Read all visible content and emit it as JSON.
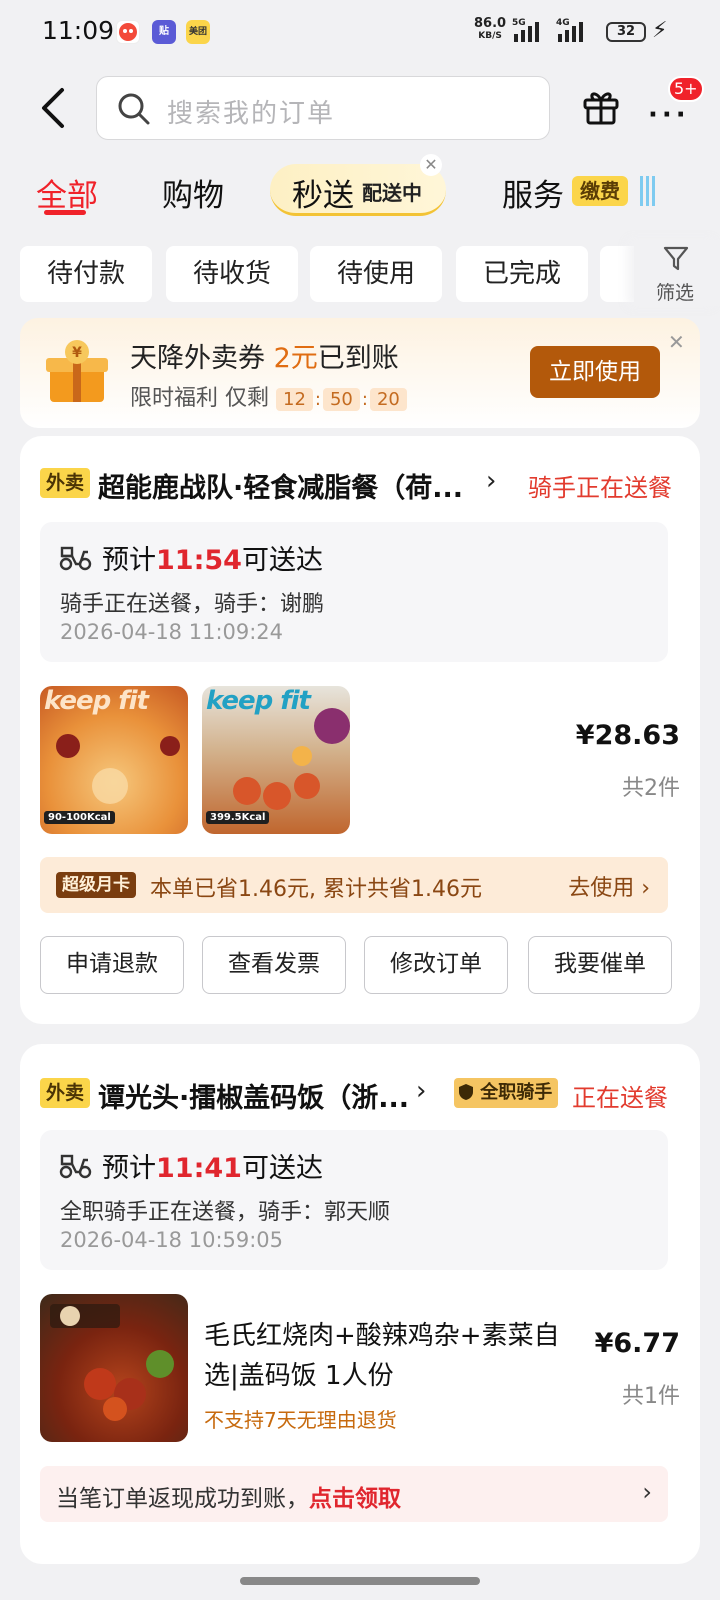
{
  "status_bar": {
    "time": "11:09",
    "net_speed": "86.0",
    "net_unit": "KB/S",
    "signal1": "5G",
    "signal2": "4G",
    "battery": "32",
    "app_icons": [
      "notification-icon",
      "tie-icon",
      "meituan-icon"
    ],
    "app_labels": [
      "",
      "贴",
      "美团"
    ]
  },
  "header": {
    "search_placeholder": "搜索我的订单",
    "more_badge": "5+"
  },
  "tabs": [
    {
      "label": "全部",
      "active": true
    },
    {
      "label": "购物"
    },
    {
      "label": "秒送",
      "sub": "配送中"
    },
    {
      "label": "服务",
      "badge": "缴费"
    }
  ],
  "filters": [
    "待付款",
    "待收货",
    "待使用",
    "已完成"
  ],
  "filter_label": "筛选",
  "coupon": {
    "title_prefix": "天降外卖券 ",
    "title_amount": "2元",
    "title_suffix": "已到账",
    "sub_prefix": "限时福利  仅剩",
    "countdown": [
      "12",
      "50",
      "20"
    ],
    "button": "立即使用"
  },
  "orders": [
    {
      "tag": "外卖",
      "shop": "超能鹿战队·轻食减脂餐（荷...",
      "status": "骑手正在送餐",
      "eta_prefix": "预计",
      "eta_time": "11:54",
      "eta_suffix": "可送达",
      "rider_text": "骑手正在送餐，骑手：谢鹏",
      "timestamp": "2026-04-18 11:09:24",
      "food_images": [
        {
          "brand": "keep fit",
          "kcal": "90-100Kcal"
        },
        {
          "brand": "keep fit",
          "kcal": "399.5Kcal"
        }
      ],
      "price": "¥28.63",
      "count": "共2件",
      "vip_badge": "超级月卡",
      "vip_text": "本单已省1.46元, 累计共省1.46元",
      "vip_action": "去使用",
      "buttons": [
        "申请退款",
        "查看发票",
        "修改订单",
        "我要催单"
      ]
    },
    {
      "tag": "外卖",
      "shop": "谭光头·擂椒盖码饭（浙...",
      "rider_badge": "全职骑手",
      "status": "正在送餐",
      "eta_prefix": "预计",
      "eta_time": "11:41",
      "eta_suffix": "可送达",
      "rider_text": "全职骑手正在送餐，骑手：郭天顺",
      "timestamp": "2026-04-18 10:59:05",
      "item_name": "毛氏红烧肉+酸辣鸡杂+素菜自选|盖码饭 1人份",
      "item_note": "不支持7天无理由退货",
      "price": "¥6.77",
      "count": "共1件",
      "cashback_text": "当笔订单返现成功到账，",
      "cashback_action": "点击领取"
    }
  ]
}
